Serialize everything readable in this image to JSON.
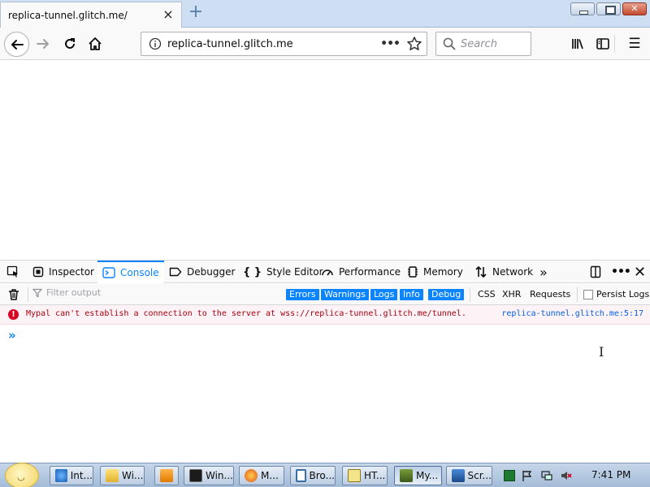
{
  "browser": {
    "tab": {
      "title": "replica-tunnel.glitch.me/",
      "close_glyph": "×"
    },
    "new_tab_glyph": "+",
    "url": "replica-tunnel.glitch.me",
    "url_actions_glyph": "•••",
    "search_placeholder": "Search",
    "menu_glyph": "☰"
  },
  "devtools": {
    "tabs": [
      {
        "label": "Inspector",
        "icon": "inspector-icon"
      },
      {
        "label": "Console",
        "icon": "console-icon",
        "selected": true
      },
      {
        "label": "Debugger",
        "icon": "debugger-icon"
      },
      {
        "label": "Style Editor",
        "icon": "style-editor-icon"
      },
      {
        "label": "Performance",
        "icon": "performance-icon"
      },
      {
        "label": "Memory",
        "icon": "memory-icon"
      },
      {
        "label": "Network",
        "icon": "network-icon"
      }
    ],
    "more_glyph": "»",
    "meatball_glyph": "•••",
    "close_glyph": "✕",
    "accent": "#0a84ff",
    "console": {
      "filter_placeholder": "Filter output",
      "levels": [
        "Errors",
        "Warnings",
        "Logs",
        "Info",
        "Debug"
      ],
      "filters": [
        "CSS",
        "XHR",
        "Requests"
      ],
      "persist_label": "Persist Logs",
      "messages": [
        {
          "level": "error",
          "text": "Mypal can't establish a connection to the server at wss://replica-tunnel.glitch.me/tunnel.",
          "location": "replica-tunnel.glitch.me:5:17"
        }
      ],
      "prompt_glyph": "»",
      "error_color": "#d70022"
    }
  },
  "taskbar": {
    "items": [
      {
        "label": "Int...",
        "icon": "internet-explorer-icon"
      },
      {
        "label": "Wi...",
        "icon": "folder-icon"
      },
      {
        "label": "",
        "icon": "media-player-icon"
      },
      {
        "label": "Win...",
        "icon": "terminal-icon"
      },
      {
        "label": "M...",
        "icon": "firefox-icon"
      },
      {
        "label": "Bro...",
        "icon": "window-icon"
      },
      {
        "label": "HT...",
        "icon": "help-icon"
      },
      {
        "label": "My...",
        "icon": "mypal-icon",
        "active": true
      },
      {
        "label": "Scr...",
        "icon": "screen-capture-icon"
      }
    ],
    "clock": "7:41 PM"
  }
}
